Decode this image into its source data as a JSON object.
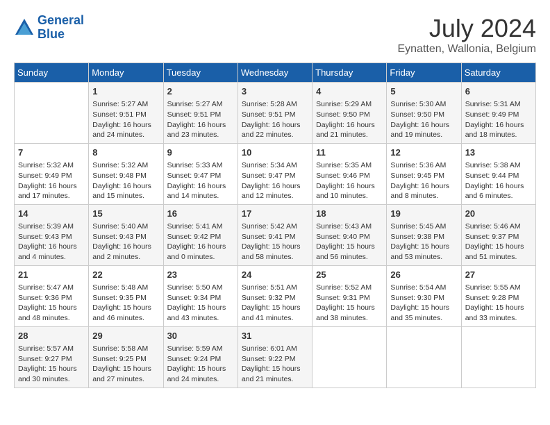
{
  "header": {
    "logo_line1": "General",
    "logo_line2": "Blue",
    "month_title": "July 2024",
    "subtitle": "Eynatten, Wallonia, Belgium"
  },
  "days_of_week": [
    "Sunday",
    "Monday",
    "Tuesday",
    "Wednesday",
    "Thursday",
    "Friday",
    "Saturday"
  ],
  "weeks": [
    [
      {
        "day": "",
        "info": ""
      },
      {
        "day": "1",
        "info": "Sunrise: 5:27 AM\nSunset: 9:51 PM\nDaylight: 16 hours\nand 24 minutes."
      },
      {
        "day": "2",
        "info": "Sunrise: 5:27 AM\nSunset: 9:51 PM\nDaylight: 16 hours\nand 23 minutes."
      },
      {
        "day": "3",
        "info": "Sunrise: 5:28 AM\nSunset: 9:51 PM\nDaylight: 16 hours\nand 22 minutes."
      },
      {
        "day": "4",
        "info": "Sunrise: 5:29 AM\nSunset: 9:50 PM\nDaylight: 16 hours\nand 21 minutes."
      },
      {
        "day": "5",
        "info": "Sunrise: 5:30 AM\nSunset: 9:50 PM\nDaylight: 16 hours\nand 19 minutes."
      },
      {
        "day": "6",
        "info": "Sunrise: 5:31 AM\nSunset: 9:49 PM\nDaylight: 16 hours\nand 18 minutes."
      }
    ],
    [
      {
        "day": "7",
        "info": "Sunrise: 5:32 AM\nSunset: 9:49 PM\nDaylight: 16 hours\nand 17 minutes."
      },
      {
        "day": "8",
        "info": "Sunrise: 5:32 AM\nSunset: 9:48 PM\nDaylight: 16 hours\nand 15 minutes."
      },
      {
        "day": "9",
        "info": "Sunrise: 5:33 AM\nSunset: 9:47 PM\nDaylight: 16 hours\nand 14 minutes."
      },
      {
        "day": "10",
        "info": "Sunrise: 5:34 AM\nSunset: 9:47 PM\nDaylight: 16 hours\nand 12 minutes."
      },
      {
        "day": "11",
        "info": "Sunrise: 5:35 AM\nSunset: 9:46 PM\nDaylight: 16 hours\nand 10 minutes."
      },
      {
        "day": "12",
        "info": "Sunrise: 5:36 AM\nSunset: 9:45 PM\nDaylight: 16 hours\nand 8 minutes."
      },
      {
        "day": "13",
        "info": "Sunrise: 5:38 AM\nSunset: 9:44 PM\nDaylight: 16 hours\nand 6 minutes."
      }
    ],
    [
      {
        "day": "14",
        "info": "Sunrise: 5:39 AM\nSunset: 9:43 PM\nDaylight: 16 hours\nand 4 minutes."
      },
      {
        "day": "15",
        "info": "Sunrise: 5:40 AM\nSunset: 9:43 PM\nDaylight: 16 hours\nand 2 minutes."
      },
      {
        "day": "16",
        "info": "Sunrise: 5:41 AM\nSunset: 9:42 PM\nDaylight: 16 hours\nand 0 minutes."
      },
      {
        "day": "17",
        "info": "Sunrise: 5:42 AM\nSunset: 9:41 PM\nDaylight: 15 hours\nand 58 minutes."
      },
      {
        "day": "18",
        "info": "Sunrise: 5:43 AM\nSunset: 9:40 PM\nDaylight: 15 hours\nand 56 minutes."
      },
      {
        "day": "19",
        "info": "Sunrise: 5:45 AM\nSunset: 9:38 PM\nDaylight: 15 hours\nand 53 minutes."
      },
      {
        "day": "20",
        "info": "Sunrise: 5:46 AM\nSunset: 9:37 PM\nDaylight: 15 hours\nand 51 minutes."
      }
    ],
    [
      {
        "day": "21",
        "info": "Sunrise: 5:47 AM\nSunset: 9:36 PM\nDaylight: 15 hours\nand 48 minutes."
      },
      {
        "day": "22",
        "info": "Sunrise: 5:48 AM\nSunset: 9:35 PM\nDaylight: 15 hours\nand 46 minutes."
      },
      {
        "day": "23",
        "info": "Sunrise: 5:50 AM\nSunset: 9:34 PM\nDaylight: 15 hours\nand 43 minutes."
      },
      {
        "day": "24",
        "info": "Sunrise: 5:51 AM\nSunset: 9:32 PM\nDaylight: 15 hours\nand 41 minutes."
      },
      {
        "day": "25",
        "info": "Sunrise: 5:52 AM\nSunset: 9:31 PM\nDaylight: 15 hours\nand 38 minutes."
      },
      {
        "day": "26",
        "info": "Sunrise: 5:54 AM\nSunset: 9:30 PM\nDaylight: 15 hours\nand 35 minutes."
      },
      {
        "day": "27",
        "info": "Sunrise: 5:55 AM\nSunset: 9:28 PM\nDaylight: 15 hours\nand 33 minutes."
      }
    ],
    [
      {
        "day": "28",
        "info": "Sunrise: 5:57 AM\nSunset: 9:27 PM\nDaylight: 15 hours\nand 30 minutes."
      },
      {
        "day": "29",
        "info": "Sunrise: 5:58 AM\nSunset: 9:25 PM\nDaylight: 15 hours\nand 27 minutes."
      },
      {
        "day": "30",
        "info": "Sunrise: 5:59 AM\nSunset: 9:24 PM\nDaylight: 15 hours\nand 24 minutes."
      },
      {
        "day": "31",
        "info": "Sunrise: 6:01 AM\nSunset: 9:22 PM\nDaylight: 15 hours\nand 21 minutes."
      },
      {
        "day": "",
        "info": ""
      },
      {
        "day": "",
        "info": ""
      },
      {
        "day": "",
        "info": ""
      }
    ]
  ]
}
